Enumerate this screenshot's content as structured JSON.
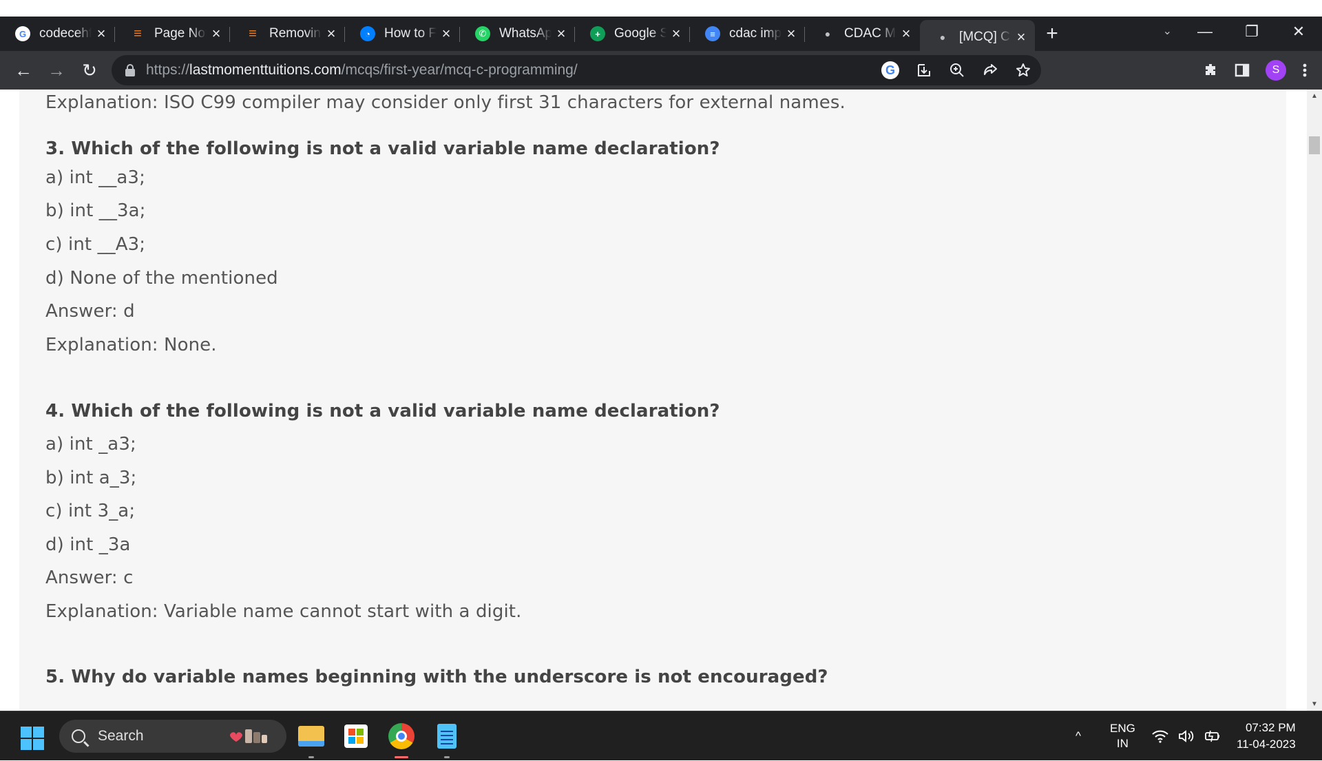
{
  "browser": {
    "tabs": [
      {
        "title": "codecehf",
        "icon": "google-icon",
        "color": "#ffffff"
      },
      {
        "title": "Page Not",
        "icon": "stackoverflow-icon",
        "color": "#f48024"
      },
      {
        "title": "Removing",
        "icon": "stackoverflow-icon",
        "color": "#f48024"
      },
      {
        "title": "How to F",
        "icon": "digitalocean-icon",
        "color": "#0080ff"
      },
      {
        "title": "WhatsApp",
        "icon": "whatsapp-icon",
        "color": "#25d366"
      },
      {
        "title": "Google S",
        "icon": "google-sheets-icon",
        "color": "#0f9d58"
      },
      {
        "title": "cdac imp",
        "icon": "google-docs-icon",
        "color": "#4285f4"
      },
      {
        "title": "CDAC MC",
        "icon": "site-icon",
        "color": "#9aa0a6"
      },
      {
        "title": "[MCQ] C",
        "icon": "site-icon",
        "color": "#9aa0a6",
        "active": true
      }
    ],
    "new_tab_glyph": "+",
    "tab_search_glyph": "⌄",
    "window_controls": {
      "minimize": "—",
      "restore": "❐",
      "close": "✕"
    },
    "nav": {
      "back": "←",
      "forward": "→",
      "reload": "↻"
    },
    "url": {
      "scheme": "https://",
      "host": "lastmomenttuitions.com",
      "path": "/mcqs/first-year/mcq-c-programming/"
    },
    "omnibox_icons": [
      "google-lens-icon",
      "install-app-icon",
      "zoom-icon",
      "share-icon",
      "bookmark-star-icon"
    ],
    "toolbar_icons": [
      "extensions-icon",
      "side-panel-icon",
      "profile-avatar",
      "menu-icon"
    ],
    "profile_initial": "S",
    "profile_color": "#a142f4"
  },
  "page": {
    "lines": [
      {
        "text": "Explanation: ISO C99 compiler may consider only first 31 characters for external names.",
        "kind": "text"
      },
      {
        "text": "3. Which of the following is not a valid variable name declaration?",
        "kind": "question"
      },
      {
        "text": "a) int __a3;",
        "kind": "text"
      },
      {
        "text": "b) int __3a;",
        "kind": "text"
      },
      {
        "text": "c) int __A3;",
        "kind": "text"
      },
      {
        "text": "d) None of the mentioned",
        "kind": "text"
      },
      {
        "text": "Answer: d",
        "kind": "text"
      },
      {
        "text": "Explanation: None.",
        "kind": "text"
      },
      {
        "text": "4. Which of the following is not a valid variable name declaration?",
        "kind": "question"
      },
      {
        "text": "a) int _a3;",
        "kind": "text"
      },
      {
        "text": "b) int a_3;",
        "kind": "text"
      },
      {
        "text": "c) int 3_a;",
        "kind": "text"
      },
      {
        "text": "d) int _3a",
        "kind": "text"
      },
      {
        "text": "Answer: c",
        "kind": "text"
      },
      {
        "text": "Explanation: Variable name cannot start with a digit.",
        "kind": "text"
      },
      {
        "text": "5. Why do variable names beginning with the underscore is not encouraged?",
        "kind": "question"
      }
    ]
  },
  "taskbar": {
    "search_placeholder": "Search",
    "apps": [
      "file-explorer-icon",
      "microsoft-store-icon",
      "chrome-icon",
      "notepad-icon"
    ],
    "tray": {
      "chevron": "^",
      "lang": "ENG",
      "region": "IN",
      "time": "07:32 PM",
      "date": "11-04-2023"
    }
  }
}
